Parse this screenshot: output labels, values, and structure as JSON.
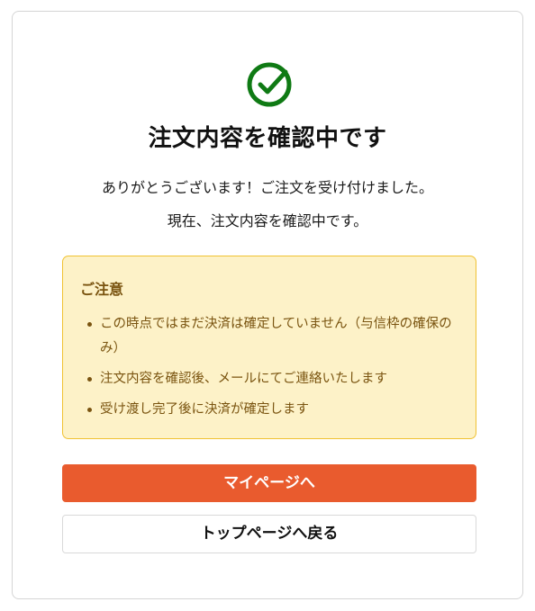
{
  "status": {
    "icon": "check-circle-icon",
    "icon_color": "#0f7a14",
    "title": "注文内容を確認中です",
    "message_line1": "ありがとうございます！ご注文を受け付けました。",
    "message_line2": "現在、注文内容を確認中です。"
  },
  "notice": {
    "title": "ご注意",
    "items": [
      "この時点ではまだ決済は確定していません（与信枠の確保のみ）",
      "注文内容を確認後、メールにてご連絡いたします",
      "受け渡し完了後に決済が確定します"
    ],
    "bg_color": "#fdf2c8",
    "border_color": "#f0c232",
    "text_color": "#7a5410"
  },
  "actions": {
    "primary_label": "マイページへ",
    "secondary_label": "トップページへ戻る",
    "primary_color": "#e95b2e"
  }
}
